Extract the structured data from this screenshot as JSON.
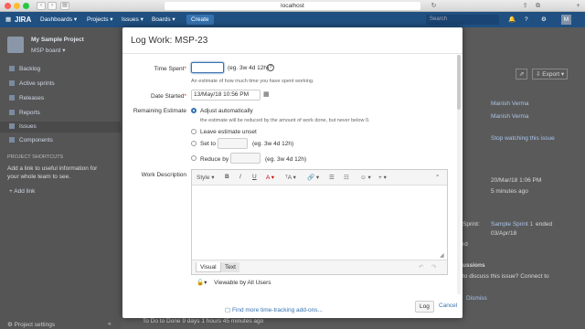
{
  "browser": {
    "url": "localhost"
  },
  "topbar": {
    "logo": "JIRA",
    "menus": [
      "Dashboards ▾",
      "Projects ▾",
      "Issues ▾",
      "Boards ▾"
    ],
    "create": "Create",
    "search_placeholder": "Search"
  },
  "sidebar": {
    "project_name": "My Sample Project",
    "board": "MSP board ▾",
    "items": [
      "Backlog",
      "Active sprints",
      "Releases",
      "Reports",
      "Issues",
      "Components"
    ],
    "shortcuts_title": "PROJECT SHORTCUTS",
    "shortcuts_text_1": "Add a link to useful information for",
    "shortcuts_text_2": "your whole team to see.",
    "add_link": "Add link",
    "settings": "Project settings"
  },
  "background": {
    "export": "Export ▾",
    "people": [
      "Manish Verma",
      "Manish Verma"
    ],
    "watch": "Stop watching this issue",
    "created": "20/Mar/18 1:06 PM",
    "ago": "5 minutes ago",
    "sprint_label": "Sprint:",
    "sprint_link": "Sample Sprint 1",
    "sprint_suffix": "ended",
    "sprint_date": "03/Apr/18",
    "rd": "rd",
    "discussions": "ussions",
    "discuss_text": "to discuss this issue? Connect to",
    "dismiss": "Dismiss",
    "bottom": "To Do to Done 9 days 1 hours 45 minutes ago"
  },
  "dialog": {
    "title": "Log Work: MSP-23",
    "time_spent_label": "Time Spent",
    "time_spent_value": "",
    "time_spent_hint": "(eg. 3w 4d 12h)",
    "time_spent_desc": "An estimate of how much time you have spent working.",
    "date_started_label": "Date Started",
    "date_started_value": "13/May/18 10:56 PM",
    "remaining_label": "Remaining Estimate",
    "options": [
      {
        "label": "Adjust automatically",
        "desc": "the estimate will be reduced by the amount of work done, but never below 0."
      },
      {
        "label": "Leave estimate unset"
      },
      {
        "label": "Set to",
        "hint": "(eg. 3w 4d 12h)"
      },
      {
        "label": "Reduce by",
        "hint": "(eg. 3w 4d 12h)"
      }
    ],
    "work_desc_label": "Work Description",
    "toolbar": [
      "Style ▾",
      "B",
      "I",
      "U",
      "A ▾",
      "ᵀA ▾",
      "🔗 ▾",
      "☰",
      "☷",
      "☺ ▾",
      "+ ▾",
      "⌃"
    ],
    "editor_tabs": [
      "Visual",
      "Text"
    ],
    "visibility": "Viewable by All Users",
    "find_addons": "Find more time-tracking add-ons...",
    "log_button": "Log",
    "cancel": "Cancel"
  },
  "colors": {
    "topbar": "#205081",
    "accent": "#3572b0"
  }
}
